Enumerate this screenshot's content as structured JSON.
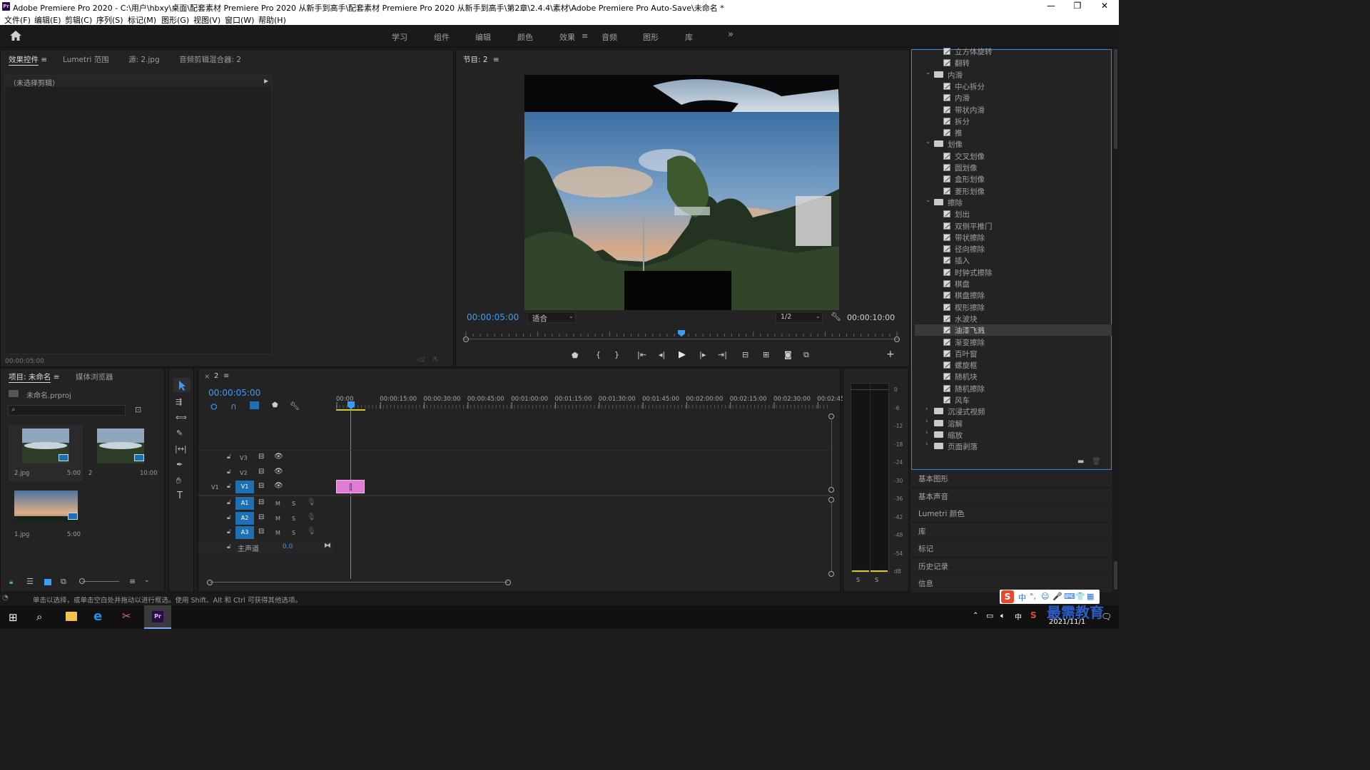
{
  "window": {
    "app_badge": "Pr",
    "title": "Adobe Premiere Pro 2020 - C:\\用户\\hbxy\\桌面\\配套素材 Premiere Pro 2020 从新手到高手\\配套素材 Premiere Pro 2020 从新手到高手\\第2章\\2.4.4\\素材\\Adobe Premiere Pro Auto-Save\\未命名 *",
    "minimize": "—",
    "maximize": "❐",
    "close": "✕"
  },
  "menu": [
    "文件(F)",
    "编辑(E)",
    "剪辑(C)",
    "序列(S)",
    "标记(M)",
    "图形(G)",
    "视图(V)",
    "窗口(W)",
    "帮助(H)"
  ],
  "workspaces": {
    "items": [
      "学习",
      "组件",
      "编辑",
      "颜色",
      "效果",
      "音频",
      "图形",
      "库"
    ],
    "active": "效果",
    "more": "»"
  },
  "source_panel": {
    "tabs": [
      "效果控件",
      "Lumetri 范围",
      "源: 2.jpg",
      "音频剪辑混合器: 2"
    ],
    "no_clip": "（未选择剪辑）",
    "timecode": "00:00:05:00"
  },
  "program_monitor": {
    "title": "节目: 2",
    "current_time": "00:00:05:00",
    "fit": "适合",
    "resolution": "1/2",
    "duration": "00:00:10:00",
    "playhead_fraction": 0.5
  },
  "project_panel": {
    "tabs": [
      "项目: 未命名",
      "媒体浏览器"
    ],
    "project_file": "未命名.prproj",
    "items": [
      {
        "name": "2.jpg",
        "duration": "5:00"
      },
      {
        "name": "2",
        "duration": "10:00"
      },
      {
        "name": "1.jpg",
        "duration": "5:00"
      }
    ]
  },
  "timeline": {
    "tab_close": "×",
    "tab_name": "2",
    "timecode": "00:00:05:00",
    "ruler": [
      "00:00",
      "00:00:15:00",
      "00:00:30:00",
      "00:00:45:00",
      "00:01:00:00",
      "00:01:15:00",
      "00:01:30:00",
      "00:01:45:00",
      "00:02:00:00",
      "00:02:15:00",
      "00:02:30:00",
      "00:02:45:"
    ],
    "video_tracks": [
      "V3",
      "V2",
      "V1"
    ],
    "audio_tracks": [
      "A1",
      "A2",
      "A3"
    ],
    "source_patch": "V1",
    "mute": "M",
    "solo": "S",
    "master_label": "主声道",
    "master_value": "0.0",
    "clip_color": "#e07bd6"
  },
  "audio_meter": {
    "scale": [
      "0",
      "-6",
      "-12",
      "-18",
      "-24",
      "-30",
      "-36",
      "-42",
      "-48",
      "-54",
      "dB"
    ],
    "solo_buttons": [
      "S",
      "S"
    ]
  },
  "effects_panel": {
    "items": [
      {
        "kind": "effect",
        "label": "立方体旋转",
        "partial": true
      },
      {
        "kind": "effect",
        "label": "翻转"
      },
      {
        "kind": "folder",
        "label": "内滑",
        "open": true
      },
      {
        "kind": "effect",
        "label": "中心拆分"
      },
      {
        "kind": "effect",
        "label": "内滑"
      },
      {
        "kind": "effect",
        "label": "带状内滑"
      },
      {
        "kind": "effect",
        "label": "拆分"
      },
      {
        "kind": "effect",
        "label": "推"
      },
      {
        "kind": "folder",
        "label": "划像",
        "open": true
      },
      {
        "kind": "effect",
        "label": "交叉划像"
      },
      {
        "kind": "effect",
        "label": "圆划像"
      },
      {
        "kind": "effect",
        "label": "盒形划像"
      },
      {
        "kind": "effect",
        "label": "菱形划像"
      },
      {
        "kind": "folder",
        "label": "擦除",
        "open": true
      },
      {
        "kind": "effect",
        "label": "划出"
      },
      {
        "kind": "effect",
        "label": "双侧平推门"
      },
      {
        "kind": "effect",
        "label": "带状擦除"
      },
      {
        "kind": "effect",
        "label": "径向擦除"
      },
      {
        "kind": "effect",
        "label": "插入"
      },
      {
        "kind": "effect",
        "label": "时钟式擦除"
      },
      {
        "kind": "effect",
        "label": "棋盘"
      },
      {
        "kind": "effect",
        "label": "棋盘擦除"
      },
      {
        "kind": "effect",
        "label": "楔形擦除"
      },
      {
        "kind": "effect",
        "label": "水波块"
      },
      {
        "kind": "effect",
        "label": "油漆飞溅",
        "selected": true
      },
      {
        "kind": "effect",
        "label": "渐变擦除"
      },
      {
        "kind": "effect",
        "label": "百叶窗"
      },
      {
        "kind": "effect",
        "label": "螺旋框"
      },
      {
        "kind": "effect",
        "label": "随机块"
      },
      {
        "kind": "effect",
        "label": "随机擦除"
      },
      {
        "kind": "effect",
        "label": "风车"
      },
      {
        "kind": "folder",
        "label": "沉浸式视频",
        "open": false
      },
      {
        "kind": "folder",
        "label": "溶解",
        "open": false
      },
      {
        "kind": "folder",
        "label": "缩放",
        "open": false
      },
      {
        "kind": "folder",
        "label": "页面剥落",
        "open": false
      }
    ]
  },
  "side_panels": [
    "基本图形",
    "基本声音",
    "Lumetri 颜色",
    "库",
    "标记",
    "历史记录",
    "信息"
  ],
  "status_bar": "单击以选择，或单击空白处并拖动以进行框选。使用 Shift、Alt 和 Ctrl 可获得其他选项。",
  "taskbar": {
    "date": "2021/11/1",
    "watermark": "最需教育",
    "ime_items": [
      "中",
      "°,",
      "☺",
      "🎤",
      "⌨",
      "👕",
      "▦"
    ]
  },
  "colors": {
    "accent": "#3b9cff",
    "panel": "#232323",
    "clip": "#e07bd6",
    "track_select": "#1f6fb3"
  }
}
